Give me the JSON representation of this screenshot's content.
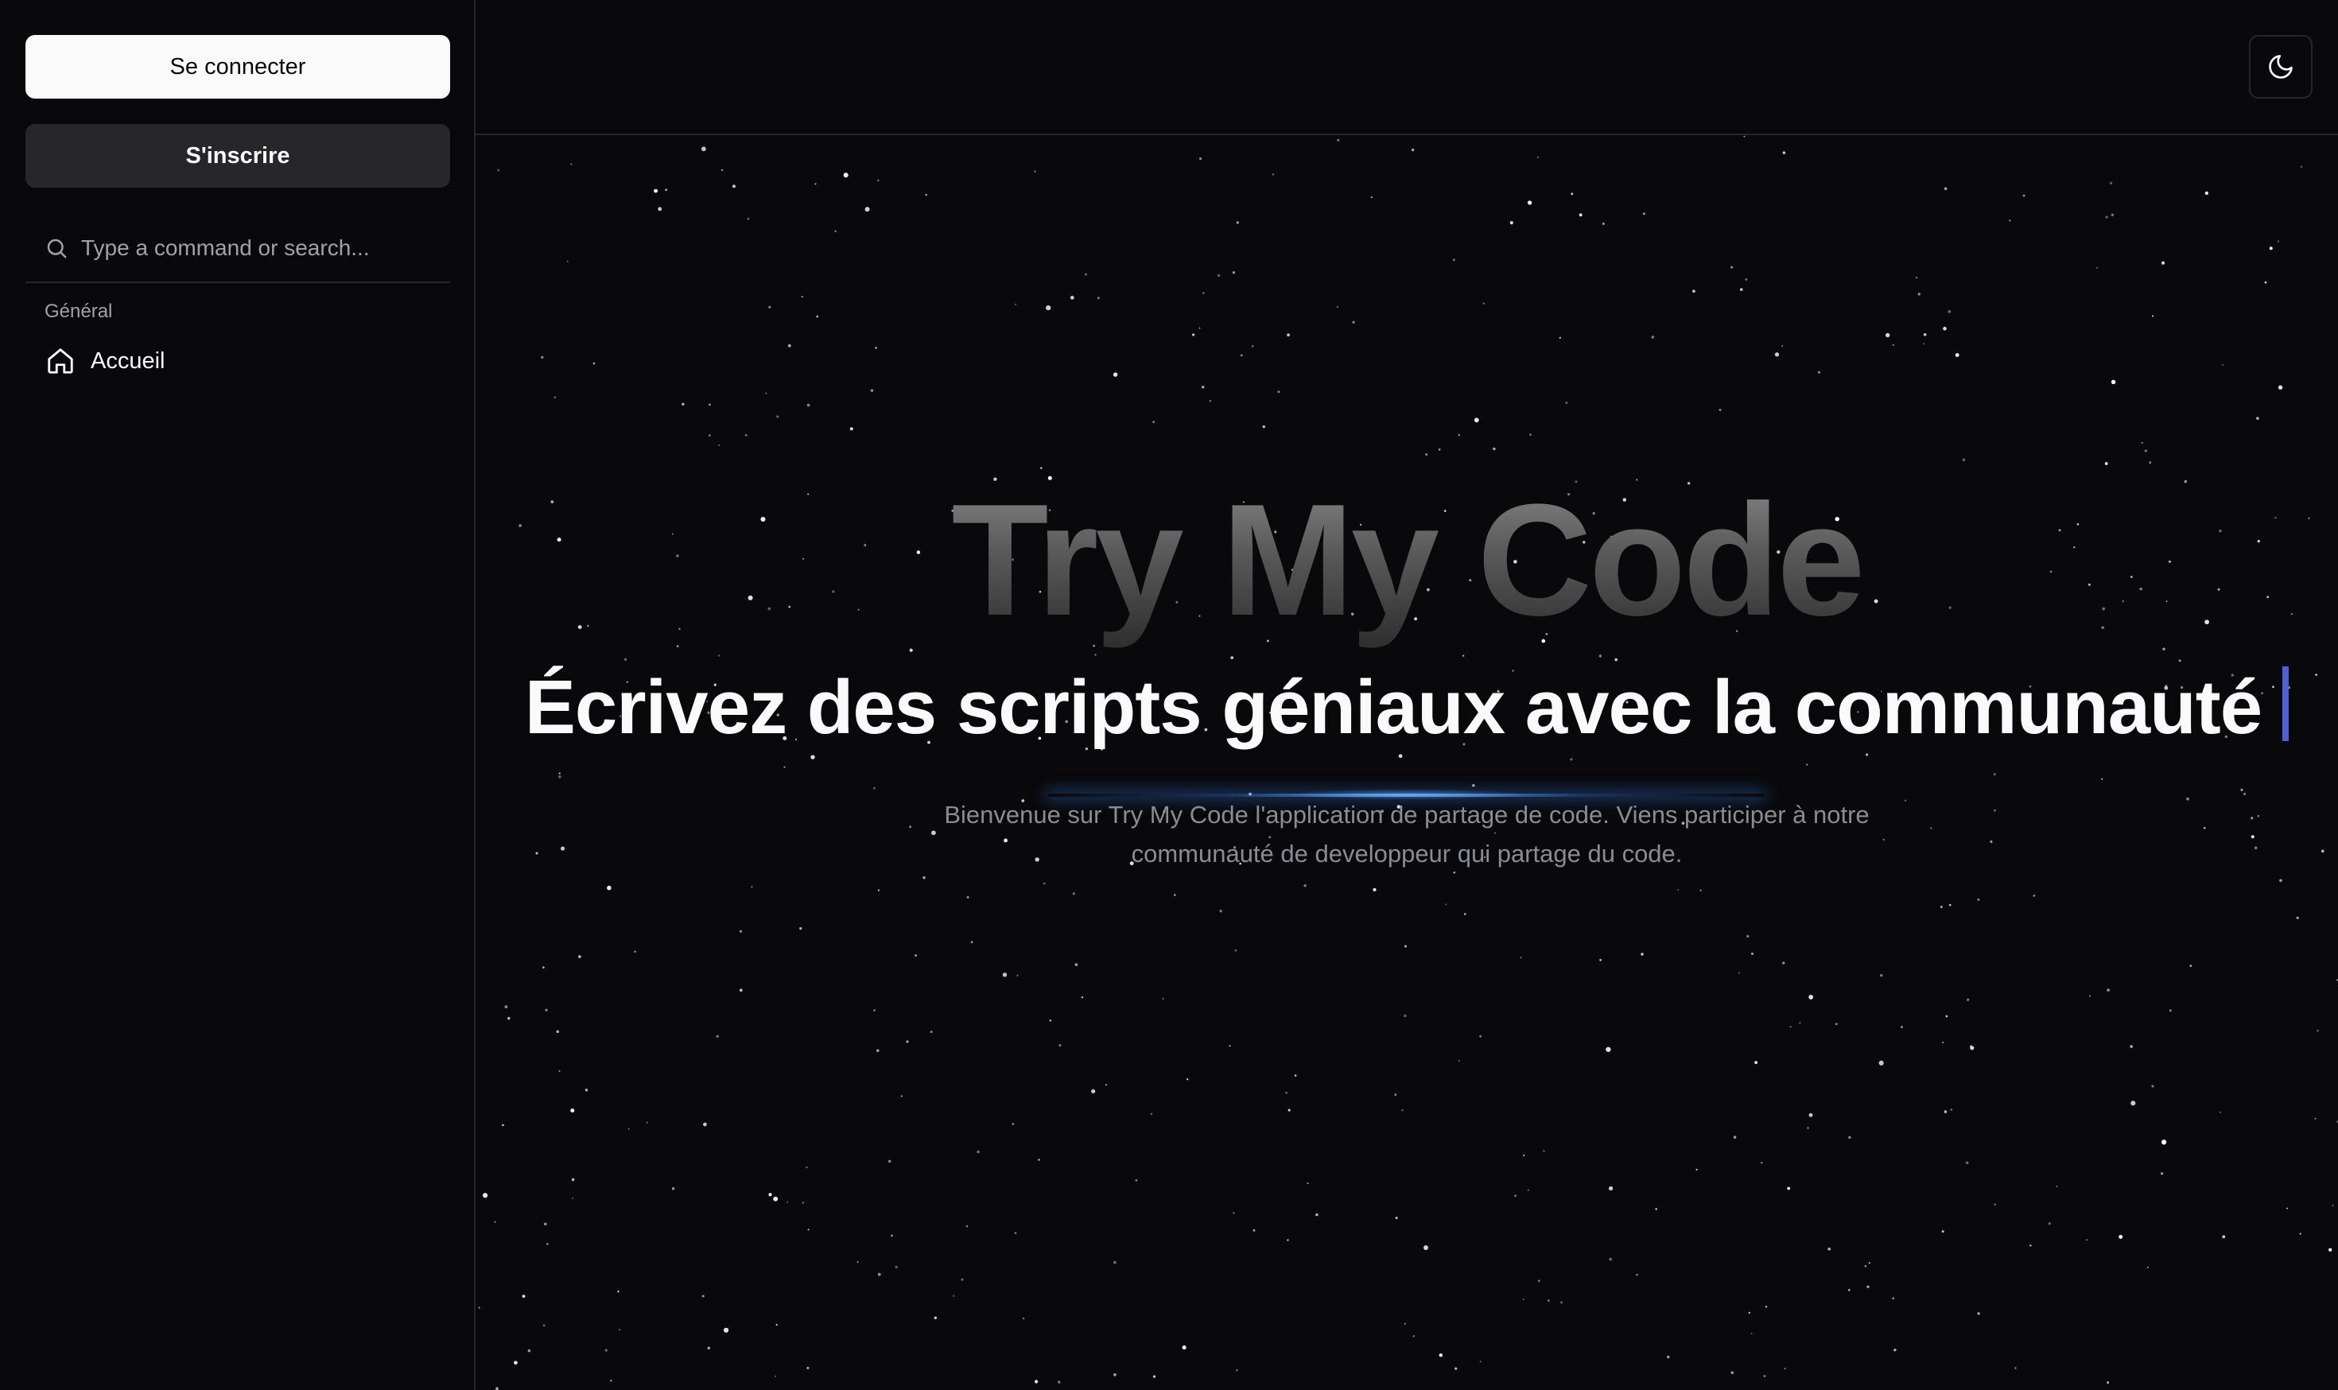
{
  "sidebar": {
    "login_label": "Se connecter",
    "signup_label": "S'inscrire",
    "search": {
      "placeholder": "Type a command or search...",
      "value": "",
      "icon": "search-icon"
    },
    "group_label": "Général",
    "items": [
      {
        "label": "Accueil",
        "icon": "home-icon"
      }
    ]
  },
  "header": {
    "theme_toggle_icon": "moon-icon"
  },
  "hero": {
    "title": "Try My Code",
    "subtitle": "Écrivez des scripts géniaux avec la communauté",
    "description": "Bienvenue sur Try My Code l'application de partage de code. Viens participer à notre communauté de developpeur qui partage du code."
  },
  "colors": {
    "background": "#09090b",
    "border": "#27272a",
    "primary_button_bg": "#fafafa",
    "secondary_button_bg": "#27272a",
    "cursor_accent": "#4f5fd6",
    "glow_accent": "#60a5fa",
    "muted_text": "#a1a1aa"
  }
}
